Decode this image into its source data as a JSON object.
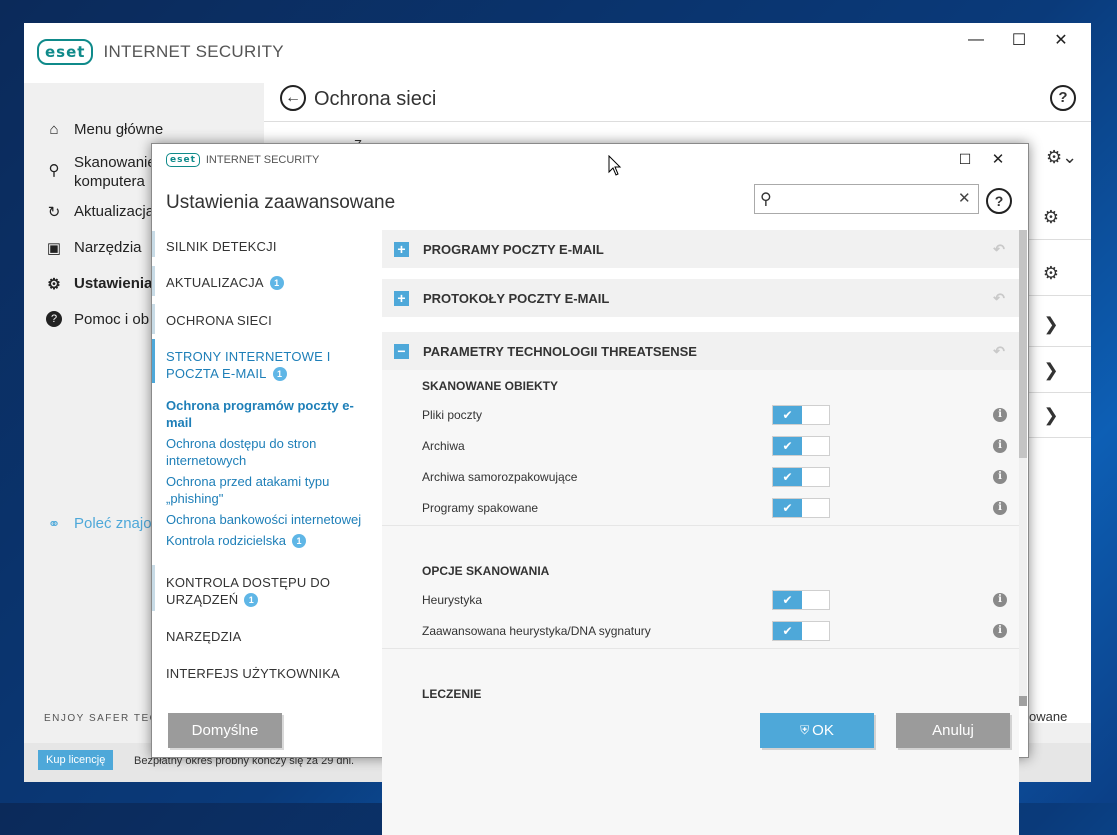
{
  "main_window": {
    "brand": "INTERNET SECURITY",
    "logo_text": "eset",
    "page_title": "Ochrona sieci",
    "sidebar": [
      {
        "label": "Menu główne",
        "icon": "home-icon"
      },
      {
        "label": "Skanowanie",
        "label2": "komputera",
        "icon": "search-icon"
      },
      {
        "label": "Aktualizacja",
        "icon": "refresh-icon"
      },
      {
        "label": "Narzędzia",
        "icon": "briefcase-icon"
      },
      {
        "label": "Ustawienia",
        "icon": "gear-icon"
      },
      {
        "label": "Pomoc i ob",
        "icon": "help-icon"
      }
    ],
    "recommend": "Poleć znajo",
    "enjoy": "ENJOY SAFER TECH",
    "buy_license": "Kup licencję",
    "trial_text": "Bezpłatny okres próbny kończy się za 29 dni.",
    "right_fragment": "owane",
    "top_fragment": "Z"
  },
  "dialog": {
    "brand": "INTERNET SECURITY",
    "logo_text": "eset",
    "title": "Ustawienia zaawansowane",
    "search_value": "",
    "nav": {
      "detection": "SILNIK DETEKCJI",
      "update": "AKTUALIZACJA",
      "network": "OCHRONA SIECI",
      "web1": "STRONY INTERNETOWE I",
      "web2": "POCZTA E-MAIL",
      "sub": {
        "mail1": "Ochrona programów poczty e-",
        "mail2": "mail",
        "web1": "Ochrona dostępu do stron",
        "web2": "internetowych",
        "phish1": "Ochrona przed atakami typu",
        "phish2": "„phishing\"",
        "bank": "Ochrona bankowości internetowej",
        "parental": "Kontrola rodzicielska"
      },
      "device1": "KONTROLA DOSTĘPU DO",
      "device2": "URZĄDZEŃ",
      "tools": "NARZĘDZIA",
      "ui": "INTERFEJS UŻYTKOWNIKA",
      "badge": "1"
    },
    "sections": {
      "clients": "PROGRAMY POCZTY E-MAIL",
      "protocols": "PROTOKOŁY POCZTY E-MAIL",
      "threatsense": "PARAMETRY TECHNOLOGII THREATSENSE"
    },
    "scanned_objects": {
      "heading": "SKANOWANE OBIEKTY",
      "items": [
        "Pliki poczty",
        "Archiwa",
        "Archiwa samorozpakowujące",
        "Programy spakowane"
      ]
    },
    "scan_options": {
      "heading": "OPCJE SKANOWANIA",
      "items": [
        "Heurystyka",
        "Zaawansowana heurystyka/DNA sygnatury"
      ]
    },
    "cleaning": {
      "heading": "LECZENIE"
    },
    "buttons": {
      "default": "Domyślne",
      "ok": "OK",
      "cancel": "Anuluj"
    },
    "colors": {
      "accent": "#4ea8d9",
      "link": "#1e7fb8",
      "brand": "#0f8a8a",
      "gray_button": "#9b9b9b"
    }
  }
}
